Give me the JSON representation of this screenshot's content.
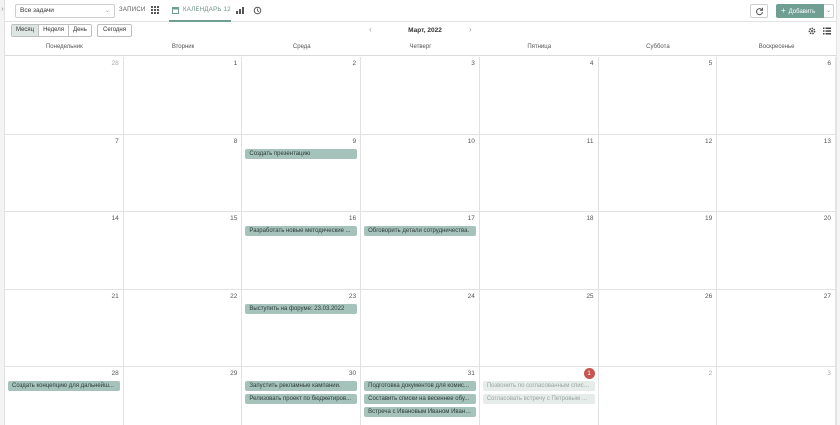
{
  "toolbar": {
    "filter_value": "Все задачи",
    "records_tab": "ЗАПИСИ",
    "calendar_tab": "КАЛЕНДАРЬ 12",
    "add_label": "Добавить"
  },
  "subbar": {
    "views": [
      "Месяц",
      "Неделя",
      "День"
    ],
    "active_view": "Месяц",
    "today_label": "Сегодня",
    "month_title": "Март, 2022"
  },
  "weekdays": [
    "Понедельник",
    "Вторник",
    "Среда",
    "Четверг",
    "Пятница",
    "Суббота",
    "Воскресенье"
  ],
  "weeks": [
    [
      {
        "d": "28",
        "other": true
      },
      {
        "d": "1"
      },
      {
        "d": "2"
      },
      {
        "d": "3"
      },
      {
        "d": "4"
      },
      {
        "d": "5"
      },
      {
        "d": "6"
      }
    ],
    [
      {
        "d": "7"
      },
      {
        "d": "8"
      },
      {
        "d": "9",
        "events": [
          {
            "t": "Создать презентацию"
          }
        ]
      },
      {
        "d": "10"
      },
      {
        "d": "11"
      },
      {
        "d": "12"
      },
      {
        "d": "13"
      }
    ],
    [
      {
        "d": "14"
      },
      {
        "d": "15"
      },
      {
        "d": "16",
        "events": [
          {
            "t": "Разработать новые методические ..."
          }
        ]
      },
      {
        "d": "17",
        "events": [
          {
            "t": "Обговорить детали сотрудничества."
          }
        ]
      },
      {
        "d": "18"
      },
      {
        "d": "19"
      },
      {
        "d": "20"
      }
    ],
    [
      {
        "d": "21"
      },
      {
        "d": "22"
      },
      {
        "d": "23",
        "events": [
          {
            "t": "Выступить на форуме: 23.03.2022"
          }
        ]
      },
      {
        "d": "24"
      },
      {
        "d": "25"
      },
      {
        "d": "26"
      },
      {
        "d": "27"
      }
    ],
    [
      {
        "d": "28",
        "events": [
          {
            "t": "Создать концепцию для дальнейш..."
          }
        ]
      },
      {
        "d": "29"
      },
      {
        "d": "30",
        "events": [
          {
            "t": "Запустить рекламные кампании."
          },
          {
            "t": "Релизовать проект по бюджетиров..."
          }
        ]
      },
      {
        "d": "31",
        "events": [
          {
            "t": "Подготовка документов для комис..."
          },
          {
            "t": "Составить списки на весеннее обу..."
          },
          {
            "t": "Встреча с Ивановым Иваном Ивано..."
          }
        ]
      },
      {
        "d": "1",
        "today": true,
        "events": [
          {
            "t": "Позвонить по согласованным списк...",
            "faded": true
          },
          {
            "t": "Согласовать встречу с Петровым А...",
            "faded": true
          }
        ]
      },
      {
        "d": "2",
        "other": true
      },
      {
        "d": "3",
        "other": true
      }
    ]
  ],
  "colors": {
    "accent": "#6f9f92",
    "event_bg": "#a5c2bb",
    "today_badge": "#c7554f"
  }
}
